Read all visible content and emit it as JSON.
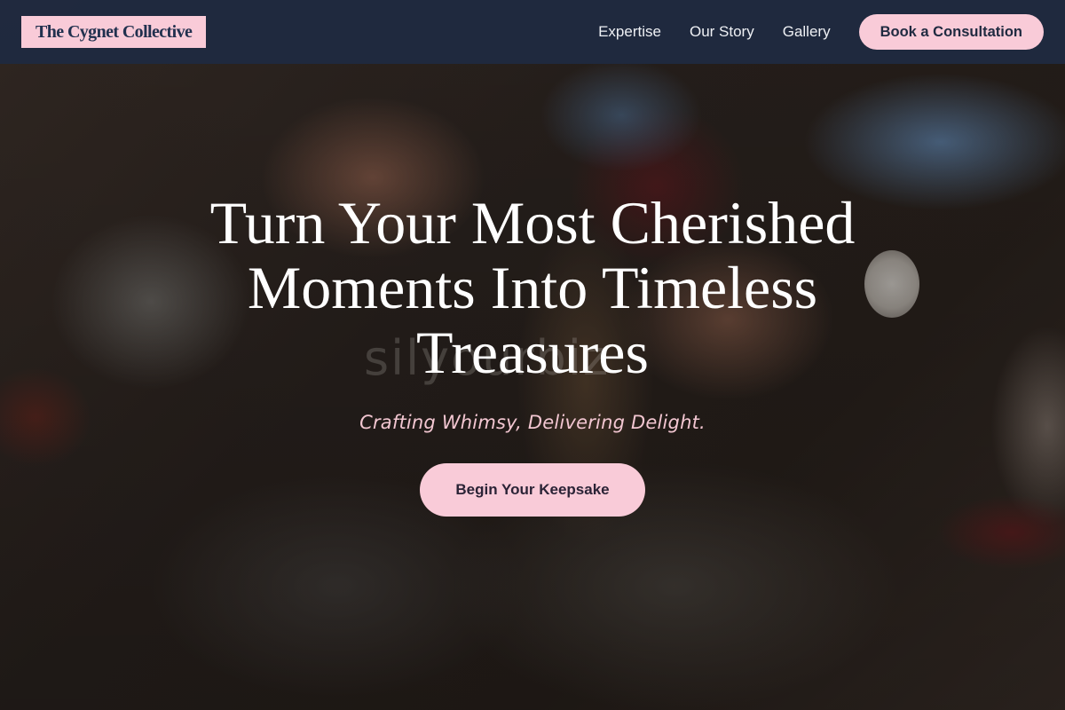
{
  "brand": {
    "name": "The Cygnet Collective"
  },
  "nav": {
    "links": [
      "Expertise",
      "Our Story",
      "Gallery"
    ],
    "cta_label": "Book a Consultation"
  },
  "hero": {
    "title": "Turn Your Most Cherished Moments Into Timeless Treasures",
    "tagline": "Crafting Whimsy, Delivering Delight.",
    "cta_label": "Begin Your Keepsake",
    "background_image": "blurred photo of an older craftsman's hands working on a wooden piece, wearing a wristwatch and a dark red apron",
    "watermark_text": "silyourbiz"
  },
  "colors": {
    "navbar": "#1f2a40",
    "accent_pink": "#f9cbd8",
    "tagline_pink": "#f2c6d1",
    "title_white": "#ffffff"
  }
}
